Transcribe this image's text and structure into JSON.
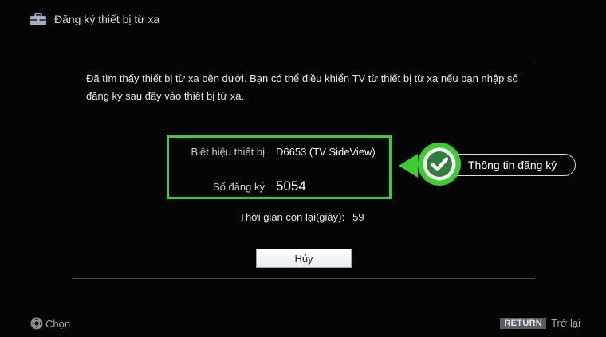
{
  "header": {
    "title": "Đăng ký thiết bị từ xa",
    "icon": "toolbox-icon"
  },
  "message": "Đã tìm thấy thiết bị từ xa bên dưới. Bạn có thể điều khiển TV từ thiết bị từ xa nếu bạn nhập số đăng ký sau đây vào thiết bị từ xa.",
  "info": {
    "device_label": "Biệt hiệu thiết bị",
    "device_value": "D6653 (TV SideView)",
    "code_label": "Số đăng ký",
    "code_value": "5054"
  },
  "callout": {
    "text": "Thông tin đăng ký",
    "icon": "check-circle-icon"
  },
  "timer": {
    "label": "Thời gian còn lại(giây):",
    "value": "59"
  },
  "cancel_label": "Hủy",
  "footer": {
    "select_label": "Chọn",
    "return_key": "RETURN",
    "back_label": "Trở lại"
  },
  "colors": {
    "highlight": "#3bcf2e",
    "background": "#050505"
  }
}
